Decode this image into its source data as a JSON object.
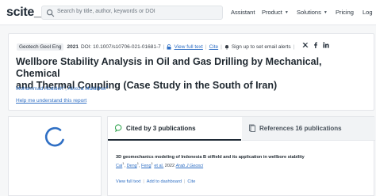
{
  "nav": {
    "logo": "scite_",
    "search_placeholder": "Search by title, author, keywords or DOI",
    "items": [
      "Assistant",
      "Product",
      "Solutions",
      "Pricing",
      "Log"
    ]
  },
  "paper": {
    "journal": "Geotech Geol Eng",
    "year": "2021",
    "doi": "DOI: 10.1007/s10706-021-01681-7",
    "view_full_text": "View full text",
    "cite": "Cite",
    "alerts": "Sign up to set email alerts",
    "title_line1": "Wellbore Stability Analysis in Oil and Gas Drilling by Mechanical, Chemical",
    "title_line2": "and Thermal Coupling (Case Study in the South of Iran)",
    "authors": [
      {
        "name": "Mohammad Abdideh",
        "sup": "1"
      },
      {
        "name": "Alireza Mafakher",
        "sup": "1"
      }
    ],
    "help": "Help me understand this report"
  },
  "citations": {
    "tab_cited": "Cited by 3 publications",
    "tab_refs": "References 16 publications",
    "item": {
      "title": "3D geomechanics modeling of Indonesia B oilfield and its application in wellbore stability",
      "author1": "Cai",
      "author1_sup": "1",
      "author2": "Deng",
      "author2_sup": "1",
      "author3": "Feng",
      "author3_sup": "1",
      "etal": "et al.",
      "year": "2022",
      "journal": "Arab J Geosci",
      "view_full_text": "View full text",
      "add_to_dashboard": "Add to dashboard",
      "cite": "Cite"
    }
  },
  "colors": {
    "link": "#2f6fc4",
    "spinner": "#2f6fc4",
    "citing_icon": "#3aa857",
    "dark": "#1f2a36"
  }
}
